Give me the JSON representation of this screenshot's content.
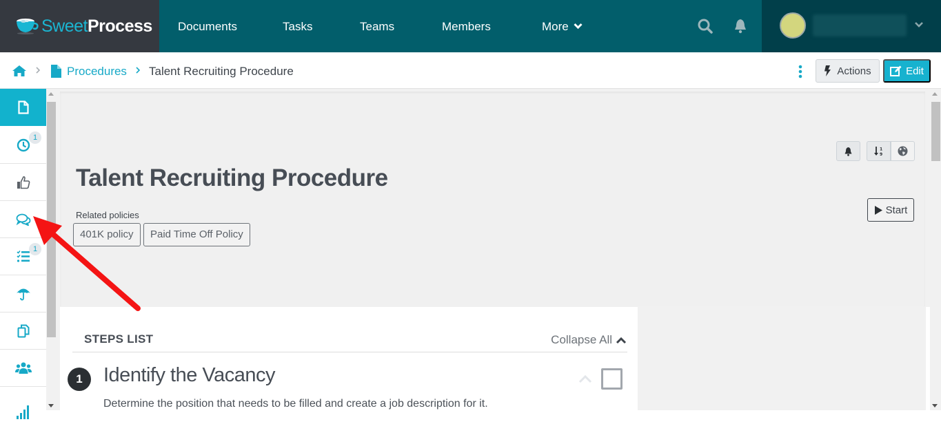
{
  "app": {
    "brand_sweet": "Sweet",
    "brand_process": "Process"
  },
  "nav": {
    "items": [
      {
        "label": "Documents"
      },
      {
        "label": "Tasks"
      },
      {
        "label": "Teams"
      },
      {
        "label": "Members"
      },
      {
        "label": "More"
      }
    ],
    "icons": [
      "search-icon",
      "bell-icon"
    ],
    "user": {
      "avatar_color": "#d3d67e",
      "name": ""
    }
  },
  "breadcrumb": {
    "home_icon": "home-icon",
    "items": [
      {
        "label": "Procedures",
        "icon": "file-icon"
      },
      {
        "label": "Talent Recruiting Procedure"
      }
    ]
  },
  "toolbar": {
    "actions_label": "Actions",
    "edit_label": "Edit"
  },
  "sidebar": {
    "items": [
      {
        "icon": "document-icon",
        "active": true
      },
      {
        "icon": "clock-icon",
        "badge": "1"
      },
      {
        "icon": "thumbs-up-icon"
      },
      {
        "icon": "comments-icon"
      },
      {
        "icon": "task-list-icon",
        "badge": "1"
      },
      {
        "icon": "umbrella-icon"
      },
      {
        "icon": "copy-icon"
      },
      {
        "icon": "users-icon"
      },
      {
        "icon": "signal-icon"
      }
    ]
  },
  "document": {
    "title": "Talent Recruiting Procedure",
    "related_label": "Related policies",
    "policies": [
      "401K policy",
      "Paid Time Off Policy"
    ],
    "start_label": "Start",
    "tool_icons": [
      "bell-icon",
      "sort-numeric-icon",
      "globe-icon"
    ]
  },
  "steps": {
    "header": "STEPS LIST",
    "collapse_label": "Collapse All",
    "items": [
      {
        "number": "1",
        "title": "Identify the Vacancy",
        "description": "Determine the position that needs to be filled and create a job description for it.",
        "checked": false
      }
    ]
  },
  "colors": {
    "accent": "#12b2cd",
    "nav_bg": "#025e6b",
    "brand_bg": "#353940",
    "user_bg": "#013f4a",
    "annotation_arrow": "#f41414"
  }
}
